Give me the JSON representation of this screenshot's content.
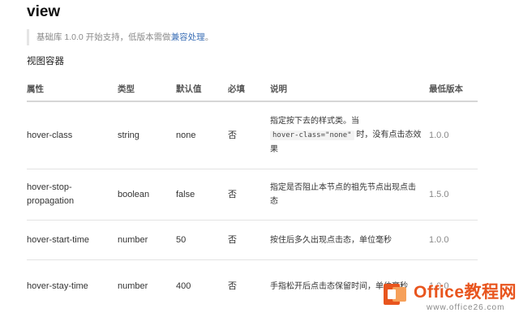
{
  "page": {
    "title": "view",
    "tip_prefix": "基础库 1.0.0 开始支持，低版本需做",
    "tip_link": "兼容处理",
    "tip_suffix": "。",
    "section": "视图容器"
  },
  "table": {
    "headers": [
      "属性",
      "类型",
      "默认值",
      "必填",
      "说明",
      "最低版本"
    ],
    "rows": [
      {
        "attr": "hover-class",
        "type": "string",
        "default": "none",
        "required": "否",
        "desc_before": "指定按下去的样式类。当",
        "desc_code": "hover-class=\"none\"",
        "desc_after": " 时，没有点击态效果",
        "version": "1.0.0"
      },
      {
        "attr": "hover-stop-propagation",
        "type": "boolean",
        "default": "false",
        "required": "否",
        "desc_before": "指定是否阻止本节点的祖先节点出现点击态",
        "desc_code": "",
        "desc_after": "",
        "version": "1.5.0"
      },
      {
        "attr": "hover-start-time",
        "type": "number",
        "default": "50",
        "required": "否",
        "desc_before": "按住后多久出现点击态，单位毫秒",
        "desc_code": "",
        "desc_after": "",
        "version": "1.0.0"
      },
      {
        "attr": "hover-stay-time",
        "type": "number",
        "default": "400",
        "required": "否",
        "desc_before": "手指松开后点击态保留时间，单位毫秒",
        "desc_code": "",
        "desc_after": "",
        "version": "1.0.0"
      }
    ]
  },
  "watermark": {
    "brand": "Office教程网",
    "sub": "www.office26.com"
  }
}
